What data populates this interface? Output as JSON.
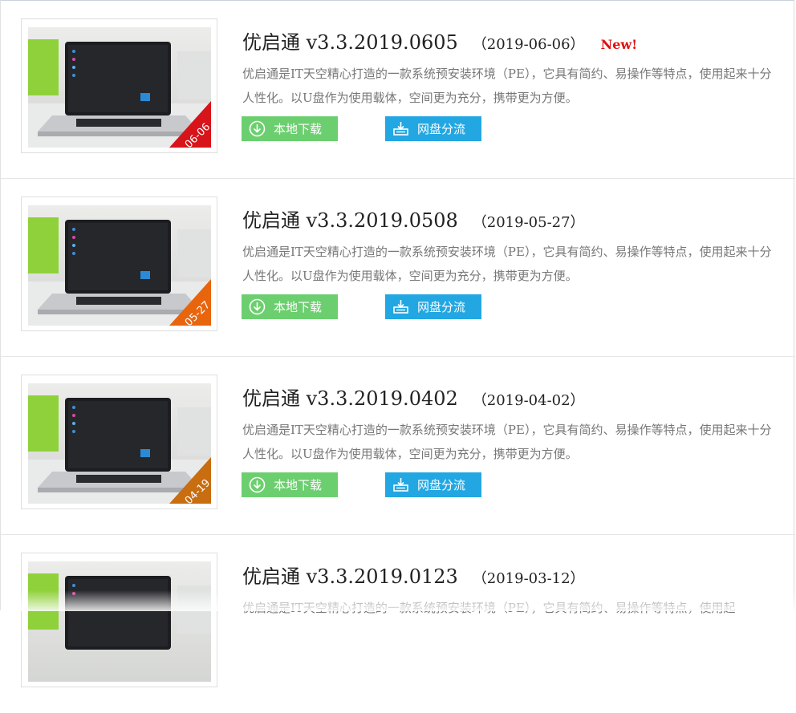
{
  "colors": {
    "title": "#222222",
    "new_badge": "#e01010",
    "desc": "#777777",
    "local_button": "#6ccf6f",
    "cloud_button": "#22a7e2",
    "ribbon_1": "#d8141b",
    "ribbon_2": "#e8650e",
    "ribbon_3": "#c86d10",
    "ribbon_4": "#2a78c9"
  },
  "items": [
    {
      "title": "优启通 v3.3.2019.0605",
      "date": "（2019-06-06）",
      "badge": "New!",
      "desc": "优启通是IT天空精心打造的一款系统预安装环境（PE），它具有简约、易操作等特点，使用起来十分人性化。以U盘作为使用载体，空间更为充分，携带更为方便。",
      "ribbon": "06-06",
      "local_label": "本地下载",
      "cloud_label": "网盘分流",
      "local_icon": "download-circle-icon",
      "cloud_icon": "cloud-disk-icon"
    },
    {
      "title": "优启通 v3.3.2019.0508",
      "date": "（2019-05-27）",
      "badge": "",
      "desc": "优启通是IT天空精心打造的一款系统预安装环境（PE），它具有简约、易操作等特点，使用起来十分人性化。以U盘作为使用载体，空间更为充分，携带更为方便。",
      "ribbon": "05-27",
      "local_label": "本地下载",
      "cloud_label": "网盘分流",
      "local_icon": "download-circle-icon",
      "cloud_icon": "cloud-disk-icon"
    },
    {
      "title": "优启通 v3.3.2019.0402",
      "date": "（2019-04-02）",
      "badge": "",
      "desc": "优启通是IT天空精心打造的一款系统预安装环境（PE），它具有简约、易操作等特点，使用起来十分人性化。以U盘作为使用载体，空间更为充分，携带更为方便。",
      "ribbon": "04-19",
      "local_label": "本地下载",
      "cloud_label": "网盘分流",
      "local_icon": "download-circle-icon",
      "cloud_icon": "cloud-disk-icon"
    },
    {
      "title": "优启通 v3.3.2019.0123",
      "date": "（2019-03-12）",
      "badge": "",
      "desc": "优启通是IT天空精心打造的一款系统预安装环境（PE），它具有简约、易操作等特点，使用起",
      "ribbon": "",
      "local_label": "",
      "cloud_label": "",
      "local_icon": "",
      "cloud_icon": ""
    }
  ]
}
